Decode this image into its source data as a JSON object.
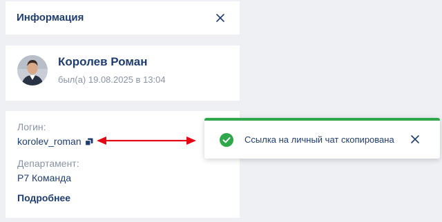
{
  "header": {
    "title": "Информация",
    "close_icon": "close-icon"
  },
  "profile": {
    "name": "Королев Роман",
    "status": "был(а) 19.08.2025 в 13:04",
    "avatar_icon": "avatar"
  },
  "info": {
    "login_label": "Логин:",
    "login_value": "korolev_roman",
    "copy_icon": "copy-icon",
    "department_label": "Департамент:",
    "department_value": "Р7 Команда",
    "more_link": "Подробнее"
  },
  "toast": {
    "message": "Ссылка на личный чат скопирована",
    "status_icon": "check-circle-icon",
    "close_icon": "close-icon",
    "accent_color": "#2ea84a"
  },
  "annotation": {
    "arrow_color": "#e30613"
  },
  "colors": {
    "text_primary": "#1f3d6e",
    "text_secondary": "#8a93a3",
    "background": "#eef0f4"
  }
}
